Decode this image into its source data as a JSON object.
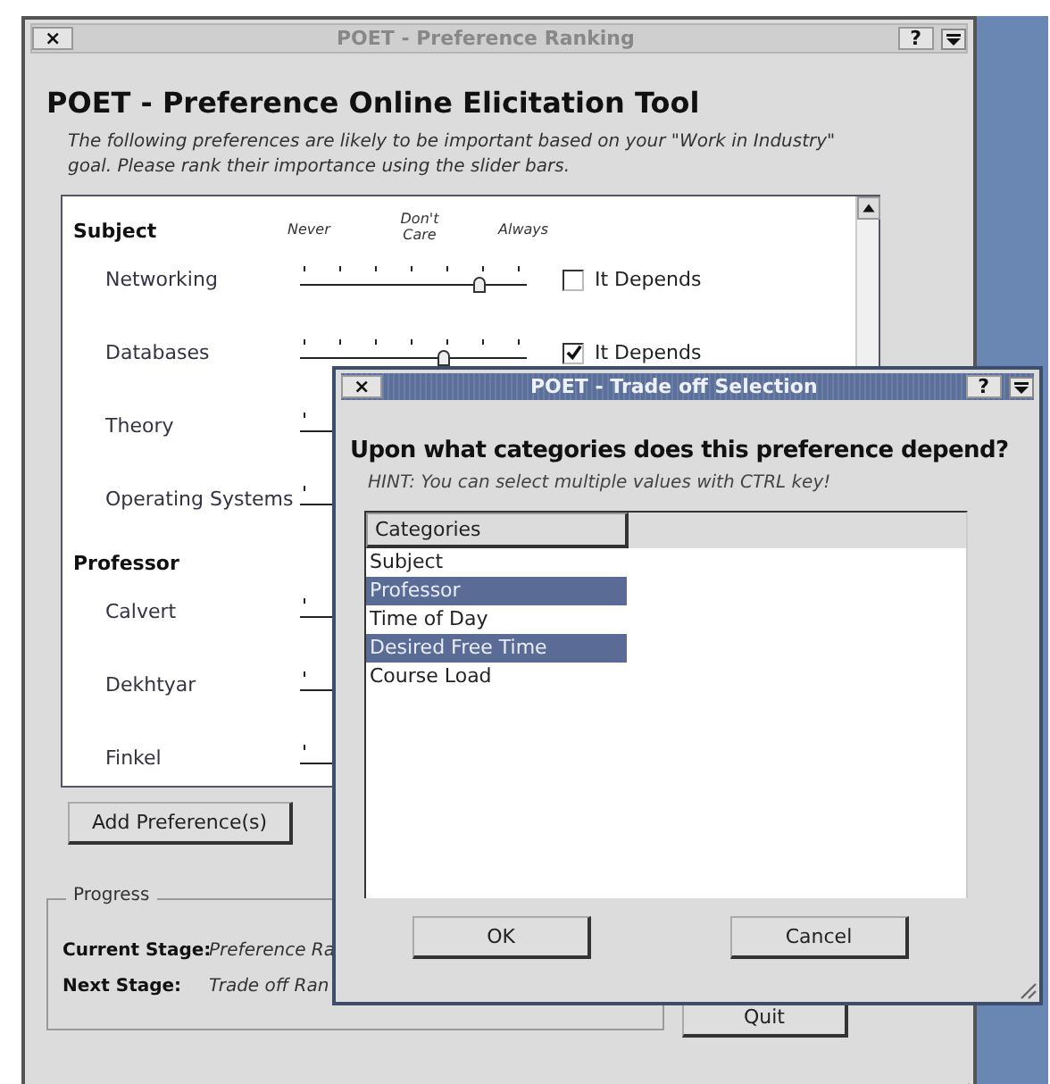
{
  "main_window": {
    "title": "POET - Preference Ranking",
    "close_glyph": "×",
    "help_glyph": "?",
    "heading": "POET - Preference Online Elicitation Tool",
    "description": "The following preferences are likely to be important based on your \"Work in Industry\" goal.  Please rank their importance using the slider bars.",
    "scale_labels": [
      "Never",
      "Don't Care",
      "Always"
    ],
    "groups": [
      {
        "name": "Subject",
        "items": [
          {
            "label": "Networking",
            "level": 0.83,
            "depends": {
              "label": "It Depends",
              "checked": false
            }
          },
          {
            "label": "Databases",
            "level": 0.67,
            "depends": {
              "label": "It Depends",
              "checked": true
            }
          },
          {
            "label": "Theory"
          },
          {
            "label": "Operating Systems"
          }
        ]
      },
      {
        "name": "Professor",
        "items": [
          {
            "label": "Calvert"
          },
          {
            "label": "Dekhtyar"
          },
          {
            "label": "Finkel"
          }
        ]
      }
    ],
    "add_button": "Add Preference(s)",
    "progress": {
      "title": "Progress",
      "rows": [
        {
          "label": "Current Stage:",
          "value": "Preference Ra"
        },
        {
          "label": "Next Stage:",
          "value": "Trade off Ran"
        }
      ]
    },
    "quit_button": "Quit"
  },
  "dialog": {
    "title": "POET - Trade off Selection",
    "close_glyph": "×",
    "help_glyph": "?",
    "question": "Upon what categories does this preference depend?",
    "hint": "HINT:  You can select multiple values with CTRL key!",
    "column": "Categories",
    "items": [
      {
        "label": "Subject",
        "selected": false
      },
      {
        "label": "Professor",
        "selected": true
      },
      {
        "label": "Time of Day",
        "selected": false
      },
      {
        "label": "Desired Free Time",
        "selected": true
      },
      {
        "label": "Course Load",
        "selected": false
      }
    ],
    "buttons": [
      "OK",
      "Cancel"
    ]
  }
}
